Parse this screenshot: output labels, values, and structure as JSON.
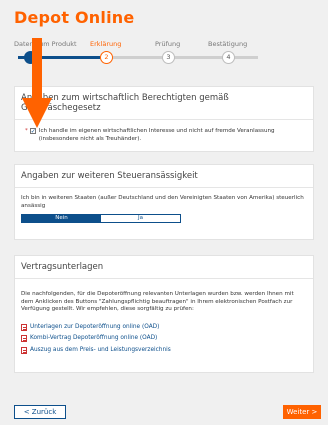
{
  "header": {
    "title": "Depot Online"
  },
  "stepper": {
    "steps": [
      {
        "label": "Daten zum Produkt",
        "number": "1"
      },
      {
        "label": "Erklärung",
        "number": "2"
      },
      {
        "label": "Prüfung",
        "number": "3"
      },
      {
        "label": "Bestätigung",
        "number": "4"
      }
    ]
  },
  "beneficiary": {
    "title": "Angaben zum wirtschaftlich Berechtigten gemäß Geldwäschegesetz",
    "asterisk": "*",
    "check_mark": "✓",
    "checkbox_text": "Ich handle im eigenen wirtschaftlichen Interesse und nicht auf fremde Veranlassung (insbesondere nicht als Treuhänder)."
  },
  "tax": {
    "title": "Angaben zur weiteren Steueransässigkeit",
    "question": "Ich bin in weiteren Staaten (außer Deutschland und den Vereinigten Staaten von Amerika) steuerlich ansässig",
    "option_no": "Nein",
    "option_yes": "Ja"
  },
  "contracts": {
    "title": "Vertragsunterlagen",
    "intro": "Die nachfolgenden, für die Depoteröffnung relevanten Unterlagen wurden bzw. werden Ihnen mit dem Anklicken des Buttons \"Zahlungspflichtig beauftragen\" in Ihrem elektronischen Postfach zur Verfügung gestellt. Wir empfehlen, diese sorgfältig zu prüfen:",
    "documents": [
      "Unterlagen zur Depoteröffnung online (OAD)",
      "Kombi-Vertrag Depoteröffnung online (OAD)",
      "Auszug aus dem Preis- und Leistungsverzeichnis"
    ]
  },
  "footer": {
    "back_label": "< Zurück",
    "next_label": "Weiter >"
  },
  "colors": {
    "brand_orange": "#ff6200",
    "brand_blue": "#0d4f8b"
  }
}
